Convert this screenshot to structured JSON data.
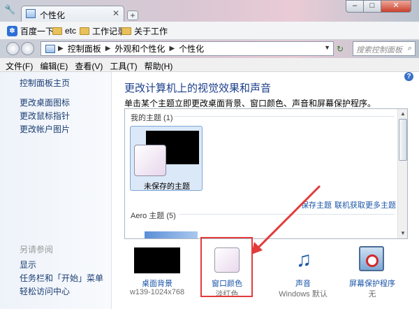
{
  "window": {
    "tab_title": "个性化",
    "tab_close": "✕",
    "new_tab": "+",
    "minimize": "–",
    "maximize": "□",
    "close": "✕"
  },
  "favorites": [
    {
      "label": "百度一下",
      "icon": "paw-icon"
    },
    {
      "label": "etc",
      "icon": "folder-icon"
    },
    {
      "label": "工作记录",
      "icon": "folder-icon"
    },
    {
      "label": "关于工作",
      "icon": "folder-icon"
    }
  ],
  "address": {
    "crumbs": [
      "控制面板",
      "外观和个性化",
      "个性化"
    ],
    "search_placeholder": "搜索控制面板"
  },
  "menu": [
    "文件(F)",
    "编辑(E)",
    "查看(V)",
    "工具(T)",
    "帮助(H)"
  ],
  "left_pane": {
    "links": [
      "控制面板主页",
      "更改桌面图标",
      "更改鼠标指针",
      "更改帐户图片"
    ],
    "see_also_title": "另请参阅",
    "see_also": [
      "显示",
      "任务栏和「开始」菜单",
      "轻松访问中心"
    ]
  },
  "main": {
    "heading": "更改计算机上的视觉效果和声音",
    "description": "单击某个主题立即更改桌面背景、窗口颜色、声音和屏幕保护程序。",
    "my_themes": "我的主题 (1)",
    "unsaved_theme": "未保存的主题",
    "save_theme": "保存主题",
    "more_themes": "联机获取更多主题",
    "aero_themes": "Aero 主题 (5)"
  },
  "bottom": [
    {
      "label": "桌面背景",
      "value": "w139-1024x768"
    },
    {
      "label": "窗口颜色",
      "value": "淡红色"
    },
    {
      "label": "声音",
      "value": "Windows 默认"
    },
    {
      "label": "屏幕保护程序",
      "value": "无"
    }
  ],
  "colors": {
    "accent_red": "#e23b3b",
    "link_blue": "#1a55a8",
    "heading_blue": "#1c3f8c"
  }
}
